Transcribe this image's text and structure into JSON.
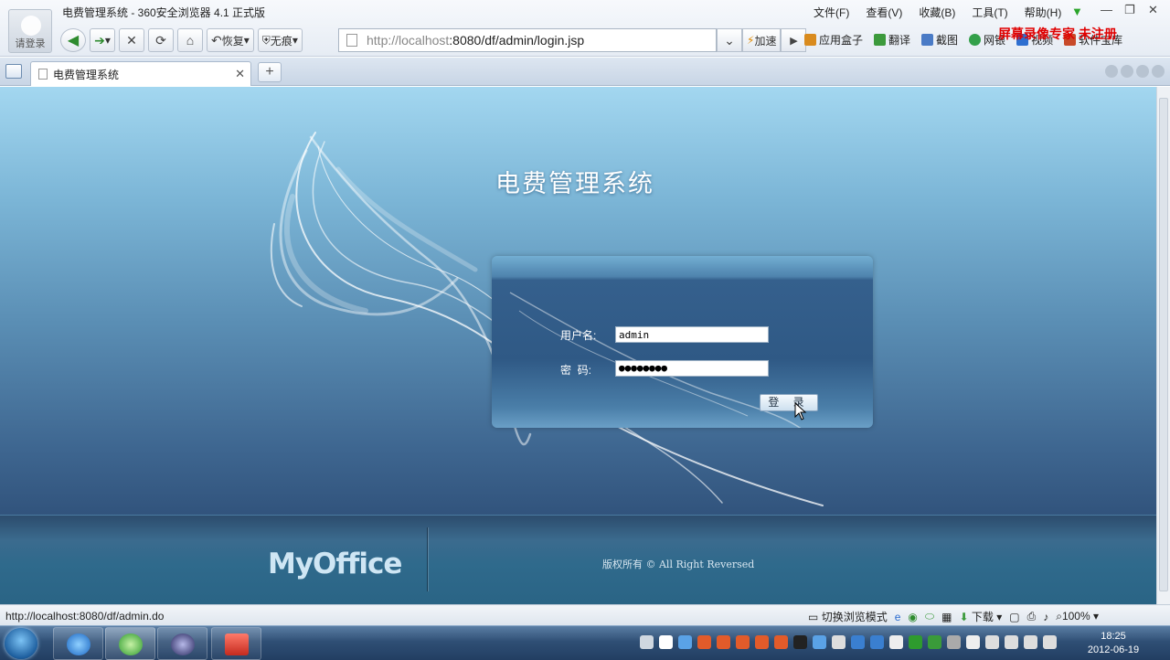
{
  "browser": {
    "window_title": "电费管理系统 - 360安全浏览器 4.1 正式版",
    "login_hint": "请登录",
    "menus": [
      "文件(F)",
      "查看(V)",
      "收藏(B)",
      "工具(T)",
      "帮助(H)"
    ],
    "watermark": "屏幕录像专家 未注册",
    "restore_label": "恢复",
    "privacy_label": "无痕",
    "address_host": "http://localhost",
    "address_rest": ":8080/df/admin/login.jsp",
    "speed_label": "加速",
    "tools": [
      "应用盒子",
      "翻译",
      "截图",
      "网银",
      "视频",
      "软件宝库"
    ],
    "tab_title": "电费管理系统"
  },
  "page": {
    "app_title": "电费管理系统",
    "username_label": "用户名:",
    "username_value": "admin",
    "password_label": "密  码:",
    "password_value": "●●●●●●●●",
    "login_button": "登 录",
    "logo_text": "MyOffice",
    "copyright": "版权所有 © All Right Reversed"
  },
  "status": {
    "url": "http://localhost:8080/df/admin.do",
    "switch_mode": "切换浏览模式",
    "download": "下载",
    "zoom": "100%"
  },
  "taskbar": {
    "time": "18:25",
    "date": "2012-06-19"
  },
  "colors": {
    "accent_green": "#2e8b2e",
    "watermark_red": "#e00000",
    "panel_blue": "#35608d"
  }
}
